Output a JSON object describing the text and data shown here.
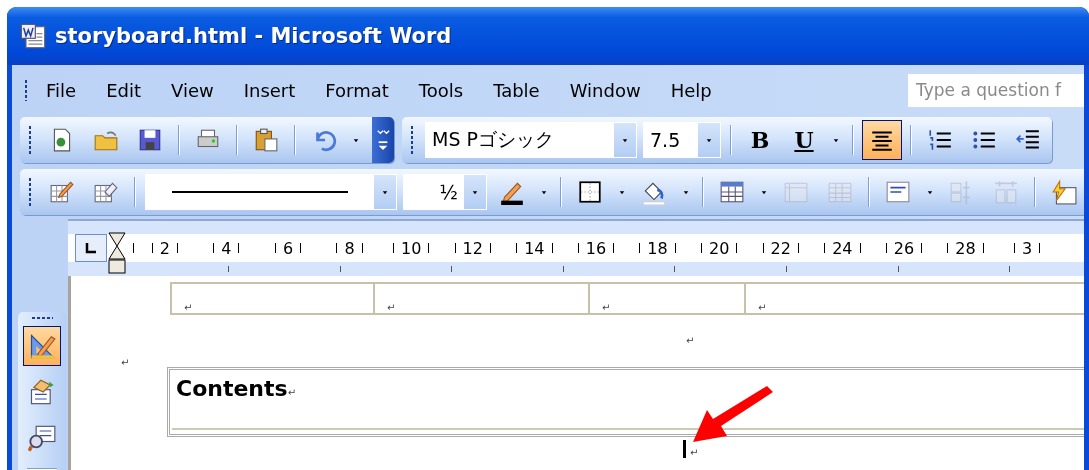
{
  "window": {
    "title": "storyboard.html - Microsoft Word"
  },
  "menu_bar": {
    "items": [
      "File",
      "Edit",
      "View",
      "Insert",
      "Format",
      "Tools",
      "Table",
      "Window",
      "Help"
    ],
    "help_box": {
      "placeholder": "Type a question f"
    }
  },
  "toolbar_rows": [
    {
      "toolbars": [
        {
          "items": [
            {
              "kind": "handle"
            },
            {
              "kind": "button"
            },
            {
              "kind": "button"
            },
            {
              "kind": "button"
            },
            {
              "kind": "separator"
            },
            {
              "kind": "button"
            },
            {
              "kind": "separator"
            },
            {
              "kind": "button"
            },
            {
              "kind": "separator"
            },
            {
              "kind": "button"
            },
            {
              "kind": "dropdown"
            },
            {
              "kind": "overflow"
            }
          ]
        },
        {
          "items": [
            {
              "kind": "handle"
            },
            {
              "kind": "combo",
              "value": "MS Pゴシック"
            },
            {
              "kind": "combo",
              "value": "7.5"
            },
            {
              "kind": "separator"
            },
            {
              "kind": "button",
              "label": "B",
              "selected": false
            },
            {
              "kind": "button",
              "label": "U",
              "selected": false
            },
            {
              "kind": "dropdown"
            },
            {
              "kind": "separator"
            },
            {
              "kind": "button",
              "selected": true
            },
            {
              "kind": "separator"
            },
            {
              "kind": "button",
              "selected": false
            },
            {
              "kind": "button",
              "selected": false
            },
            {
              "kind": "button",
              "selected": false
            }
          ]
        }
      ]
    },
    {
      "toolbars": [
        {
          "items": [
            {
              "kind": "handle"
            },
            {
              "kind": "button",
              "disabled": false
            },
            {
              "kind": "button",
              "disabled": false
            },
            {
              "kind": "separator"
            },
            {
              "kind": "line_combo"
            },
            {
              "kind": "combo",
              "value": "½"
            },
            {
              "kind": "button",
              "disabled": false
            },
            {
              "kind": "dropdown"
            },
            {
              "kind": "separator"
            },
            {
              "kind": "button",
              "disabled": false
            },
            {
              "kind": "dropdown"
            },
            {
              "kind": "button",
              "disabled": false
            },
            {
              "kind": "dropdown"
            },
            {
              "kind": "separator"
            },
            {
              "kind": "button",
              "disabled": false
            },
            {
              "kind": "dropdown"
            },
            {
              "kind": "button",
              "disabled": true
            },
            {
              "kind": "button",
              "disabled": true
            },
            {
              "kind": "separator"
            },
            {
              "kind": "button",
              "disabled": false
            },
            {
              "kind": "dropdown"
            },
            {
              "kind": "button",
              "disabled": true
            },
            {
              "kind": "button",
              "disabled": true
            },
            {
              "kind": "separator"
            },
            {
              "kind": "button",
              "disabled": false
            }
          ]
        }
      ]
    }
  ],
  "ruler": {
    "labels": [
      "2",
      "4",
      "6",
      "8",
      "10",
      "12",
      "14",
      "16",
      "18",
      "20",
      "22",
      "24",
      "26",
      "28",
      "3"
    ]
  },
  "drawing_toolbar": {
    "items": [
      {
        "selected": true
      },
      {
        "selected": false
      },
      {
        "selected": false
      }
    ]
  },
  "document": {
    "table_cells": [
      "↵",
      "↵",
      "↵",
      "↵"
    ],
    "marks": [
      "↵",
      "↵"
    ],
    "contents_box": {
      "heading": "Contents",
      "mark": "↵"
    },
    "cursor_mark": "↵"
  }
}
